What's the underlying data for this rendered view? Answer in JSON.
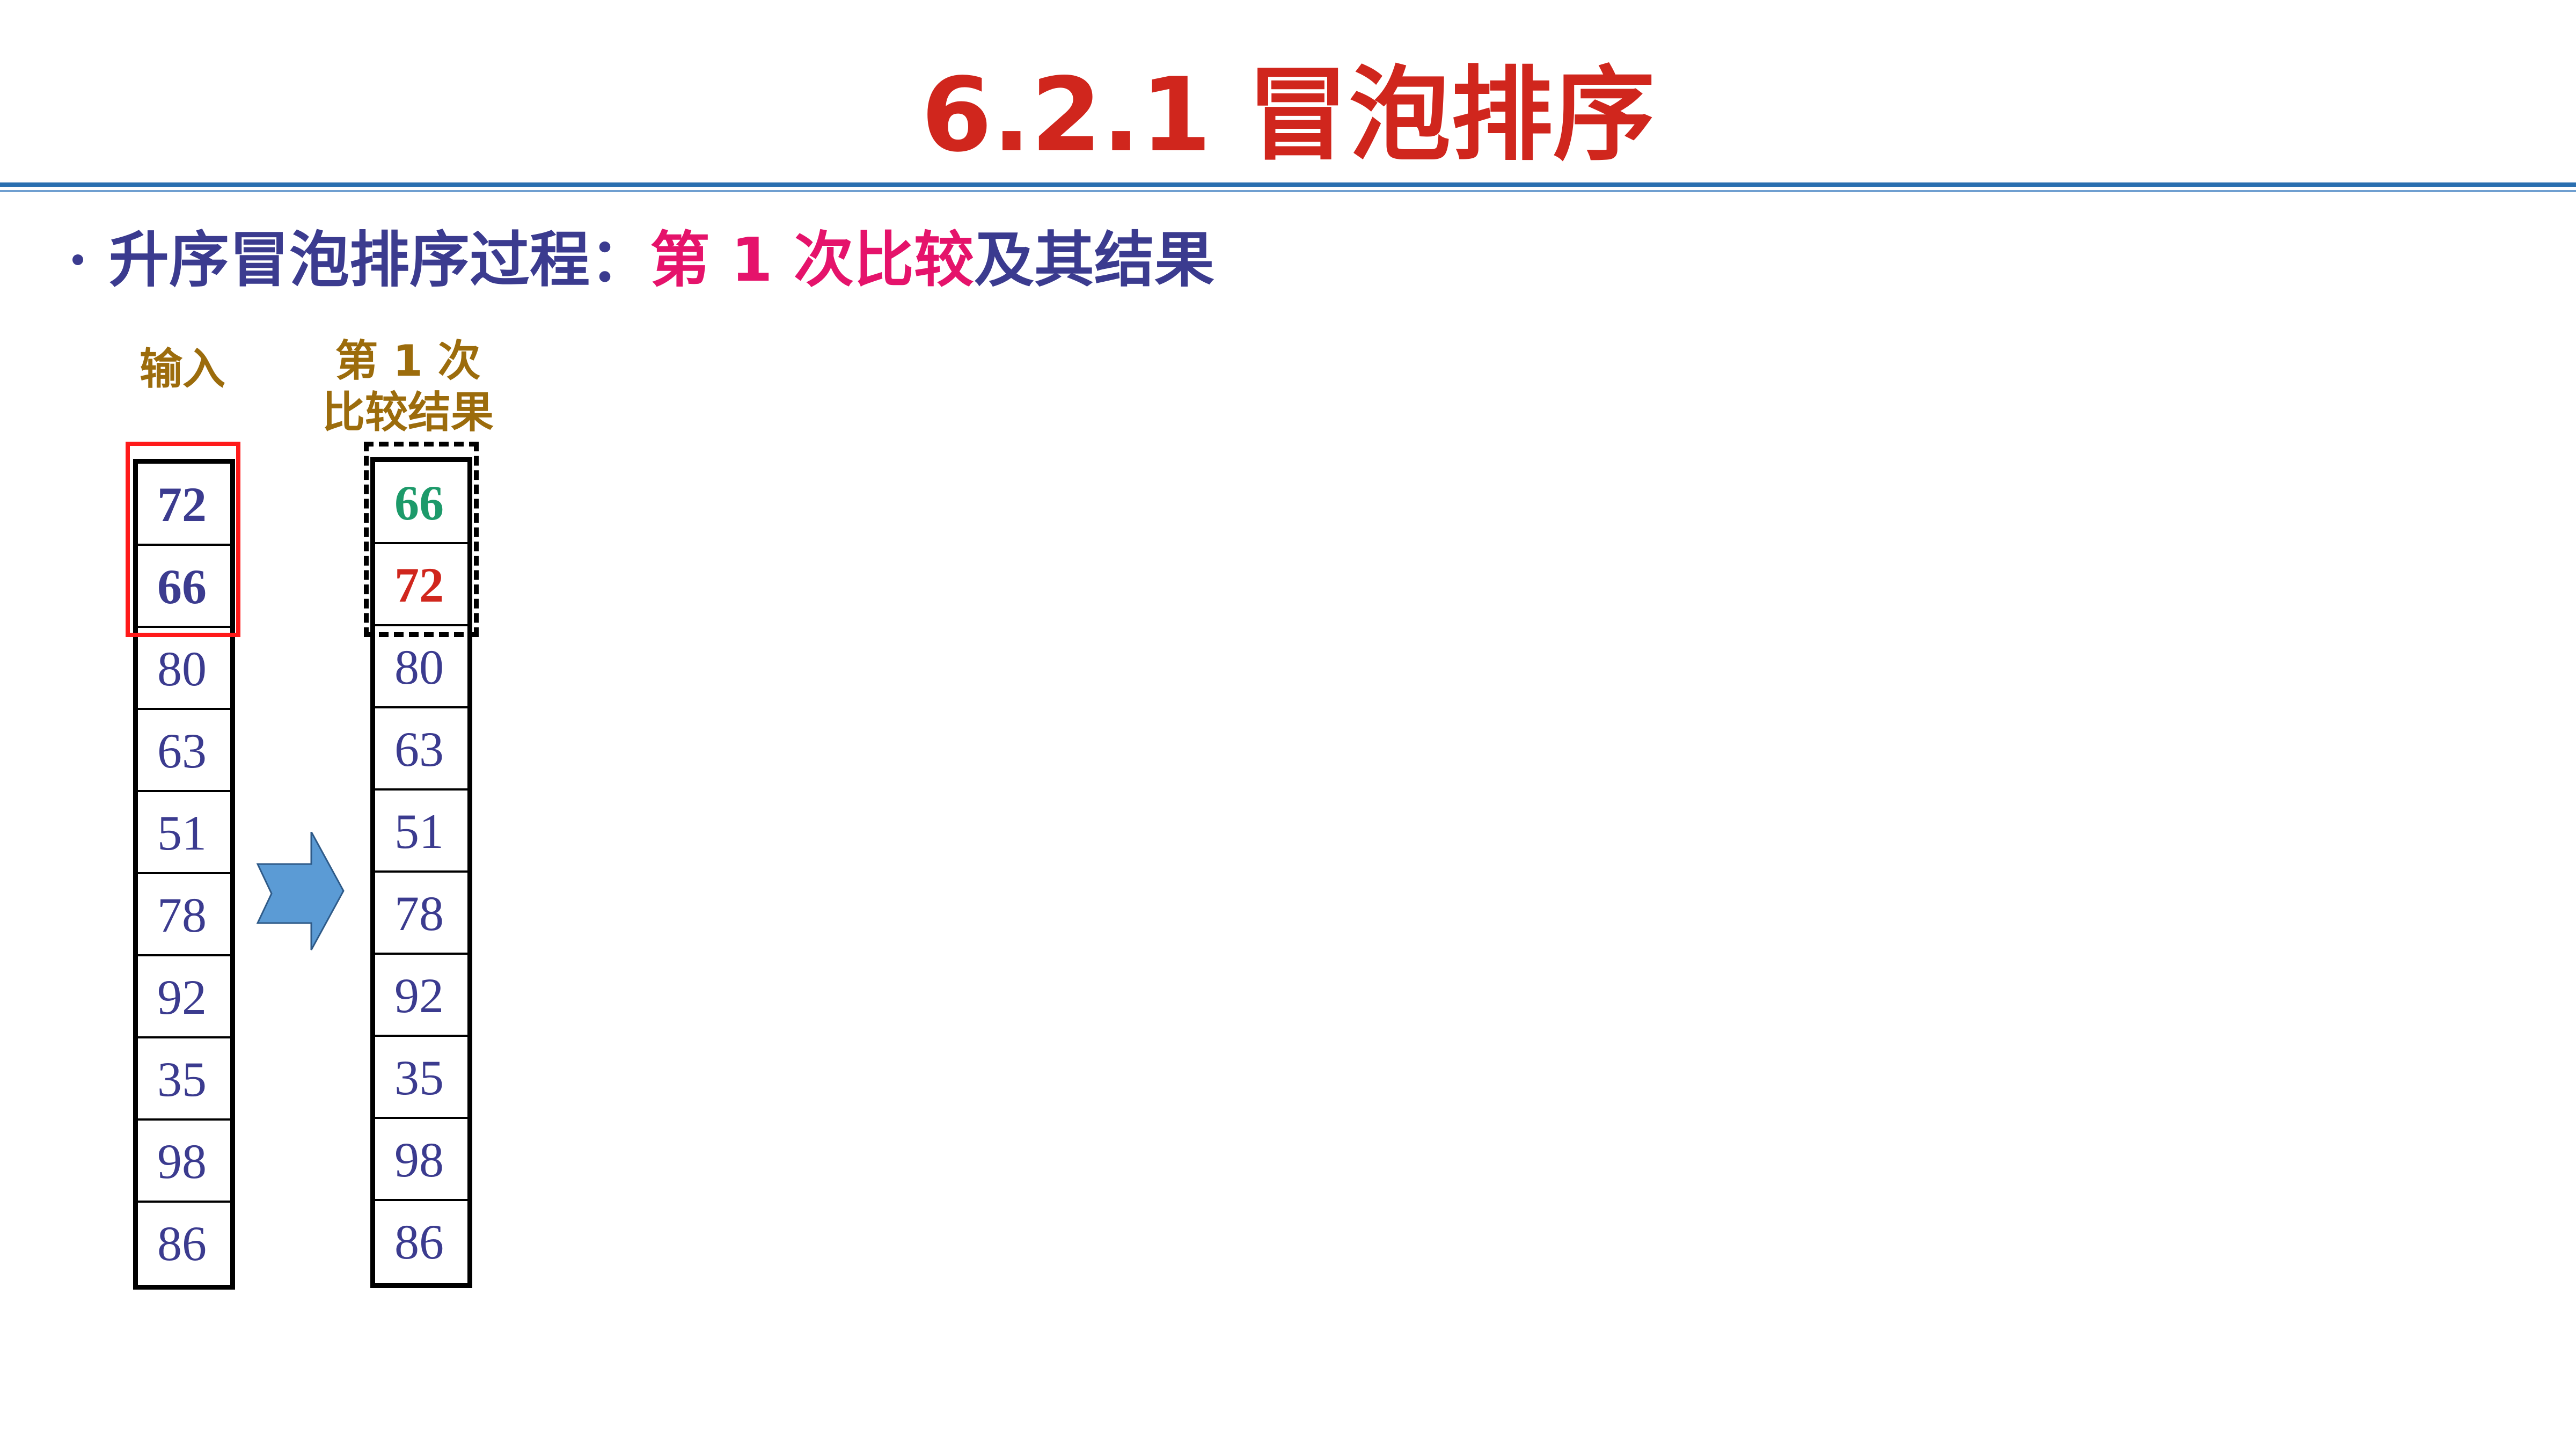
{
  "slide": {
    "title": "6.2.1 冒泡排序"
  },
  "bullet": {
    "prefix": "升序冒泡排序过程：",
    "highlight": "第 1 次比较",
    "suffix": "及其结果"
  },
  "input_column": {
    "label": "输入",
    "values": [
      "72",
      "66",
      "80",
      "63",
      "51",
      "78",
      "92",
      "35",
      "98",
      "86"
    ]
  },
  "result_column": {
    "label_line1": "第 1 次",
    "label_line2": "比较结果",
    "values": [
      "66",
      "72",
      "80",
      "63",
      "51",
      "78",
      "92",
      "35",
      "98",
      "86"
    ]
  },
  "colors": {
    "title": "#d0261d",
    "bullet_text": "#3b3b8f",
    "highlight": "#e5136b",
    "label": "#9c6c0c",
    "swapped_small": "#1d9a6a",
    "swapped_large": "#d0261d",
    "compare_frame": "#ff1a1a",
    "arrow_fill": "#5b9bd5"
  },
  "icons": {
    "arrow": "right-arrow-icon"
  }
}
